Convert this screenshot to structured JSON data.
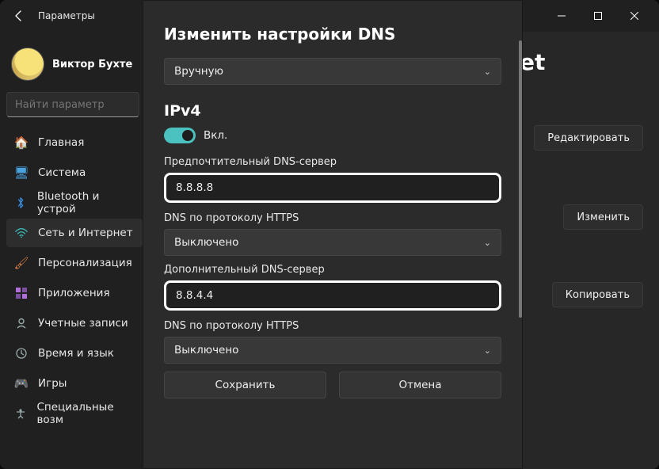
{
  "titlebar": {
    "app_title": "Параметры"
  },
  "user": {
    "display_name": "Виктор Бухте"
  },
  "search": {
    "placeholder": "Найти параметр"
  },
  "nav": {
    "items": [
      {
        "label": "Главная",
        "icon": "home-icon"
      },
      {
        "label": "Система",
        "icon": "system-icon"
      },
      {
        "label": "Bluetooth и устрой",
        "icon": "bluetooth-icon"
      },
      {
        "label": "Сеть и Интернет",
        "icon": "network-icon",
        "active": true
      },
      {
        "label": "Персонализация",
        "icon": "personalization-icon"
      },
      {
        "label": "Приложения",
        "icon": "apps-icon"
      },
      {
        "label": "Учетные записи",
        "icon": "accounts-icon"
      },
      {
        "label": "Время и язык",
        "icon": "time-icon"
      },
      {
        "label": "Игры",
        "icon": "gaming-icon"
      },
      {
        "label": "Специальные возм",
        "icon": "accessibility-icon"
      }
    ]
  },
  "background_page": {
    "heading_fragment": "et",
    "edit_label": "Редактировать",
    "change_label": "Изменить",
    "copy_label": "Копировать"
  },
  "dialog": {
    "title": "Изменить настройки DNS",
    "mode_select": {
      "value": "Вручную"
    },
    "ipv4": {
      "heading": "IPv4",
      "toggle_label": "Вкл.",
      "toggle_on": true,
      "preferred_label": "Предпочтительный DNS-сервер",
      "preferred_value": "8.8.8.8",
      "doh1_label": "DNS по протоколу HTTPS",
      "doh1_value": "Выключено",
      "alternate_label": "Дополнительный DNS-сервер",
      "alternate_value": "8.8.4.4",
      "doh2_label": "DNS по протоколу HTTPS",
      "doh2_value": "Выключено"
    },
    "save_label": "Сохранить",
    "cancel_label": "Отмена"
  }
}
